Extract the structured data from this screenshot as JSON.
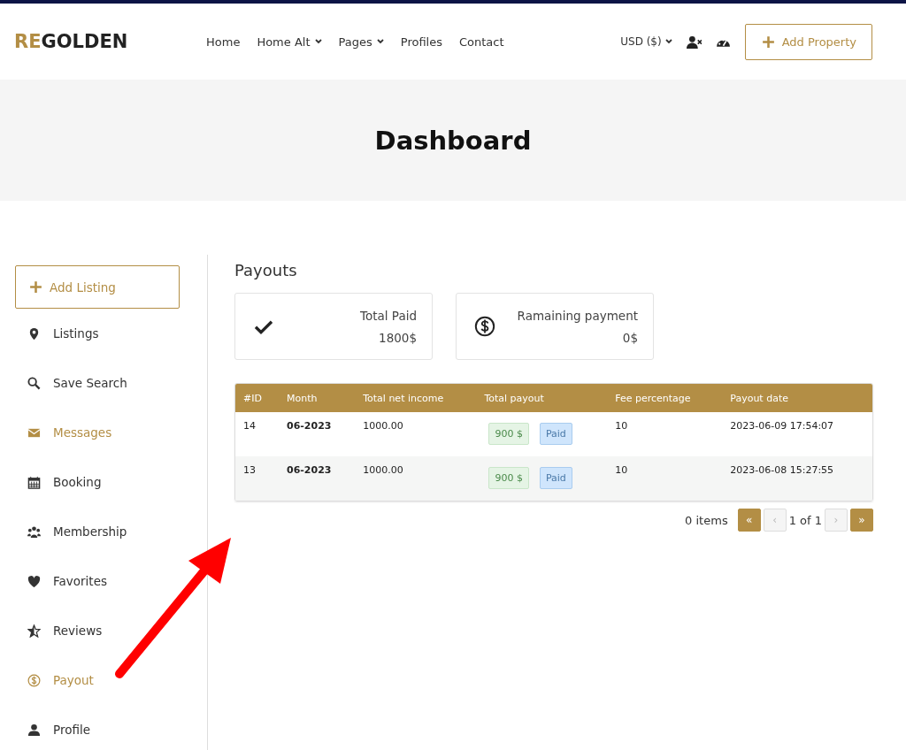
{
  "header": {
    "logo": {
      "accent": "RE",
      "rest": "GOLDEN"
    },
    "nav": [
      {
        "label": "Home",
        "dropdown": false
      },
      {
        "label": "Home Alt",
        "dropdown": true
      },
      {
        "label": "Pages",
        "dropdown": true
      },
      {
        "label": "Profiles",
        "dropdown": false
      },
      {
        "label": "Contact",
        "dropdown": false
      }
    ],
    "currency": "USD ($)",
    "add_button": "Add Property"
  },
  "hero": {
    "title": "Dashboard"
  },
  "sidebar": {
    "add_button": "Add Listing",
    "items": [
      {
        "label": "Listings",
        "kind": "pin",
        "selected": false
      },
      {
        "label": "Save Search",
        "kind": "search",
        "selected": false
      },
      {
        "label": "Messages",
        "kind": "mail",
        "selected": true
      },
      {
        "label": "Booking",
        "kind": "calendar",
        "selected": false
      },
      {
        "label": "Membership",
        "kind": "users",
        "selected": false
      },
      {
        "label": "Favorites",
        "kind": "heart",
        "selected": false
      },
      {
        "label": "Reviews",
        "kind": "star",
        "selected": false
      },
      {
        "label": "Payout",
        "kind": "dollar",
        "selected": true
      },
      {
        "label": "Profile",
        "kind": "user",
        "selected": false
      }
    ]
  },
  "main": {
    "title": "Payouts",
    "stats": [
      {
        "kind": "check",
        "label": "Total Paid",
        "value": "1800$"
      },
      {
        "kind": "dollar",
        "label": "Ramaining payment",
        "value": "0$"
      }
    ],
    "table": {
      "columns": [
        "#ID",
        "Month",
        "Total net income",
        "Total payout",
        "Fee percentage",
        "Payout date"
      ],
      "rows": [
        {
          "id": "14",
          "month": "06-2023",
          "income": "1000.00",
          "amount": "900 $",
          "status": "Paid",
          "fee": "10",
          "date": "2023-06-09 17:54:07"
        },
        {
          "id": "13",
          "month": "06-2023",
          "income": "1000.00",
          "amount": "900 $",
          "status": "Paid",
          "fee": "10",
          "date": "2023-06-08 15:27:55"
        }
      ]
    },
    "pagination": {
      "count": "0 items",
      "pages": "1 of 1",
      "buttons": [
        {
          "label": "«",
          "disabled": false
        },
        {
          "label": "‹",
          "disabled": true
        },
        {
          "label": "›",
          "disabled": true
        },
        {
          "label": "»",
          "disabled": false
        }
      ]
    }
  }
}
